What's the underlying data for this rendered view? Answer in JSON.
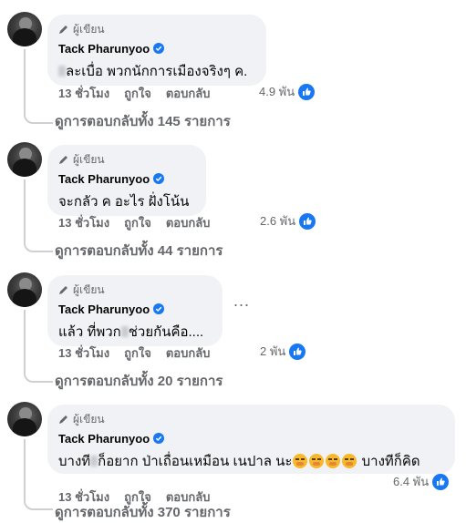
{
  "badge_label": "ผู้เขียน",
  "author_name": "Tack Pharunyoo",
  "actions": {
    "like": "ถูกใจ",
    "reply": "ตอบกลับ"
  },
  "comments": [
    {
      "text_after": "ละเบื่อ พวกนักการเมืองจริงๆ ค.",
      "time": "13 ชั่วโมง",
      "reactions": "4.9 พัน",
      "replies": "ดูการตอบกลับทั้ง 145 รายการ"
    },
    {
      "text": "จะกลัว ค อะไร ฝั่งโน้น",
      "time": "13 ชั่วโมง",
      "reactions": "2.6 พัน",
      "replies": "ดูการตอบกลับทั้ง 44 รายการ"
    },
    {
      "text_before": "แล้ว ที่พวก",
      "text_after": "ช่วยกันคือ....",
      "time": "13 ชั่วโมง",
      "reactions": "2 พัน",
      "replies": "ดูการตอบกลับทั้ง 20 รายการ",
      "more": "..."
    },
    {
      "text_before": "บางที",
      "text_mid": "ก็อยาก ป่าเถื่อนเหมือน เนปาล นะ",
      "text_after": "บางทีก็คิด",
      "time": "13 ชั่วโมง",
      "reactions": "6.4 พัน",
      "replies": "ดูการตอบกลับทั้ง 370 รายการ"
    }
  ]
}
